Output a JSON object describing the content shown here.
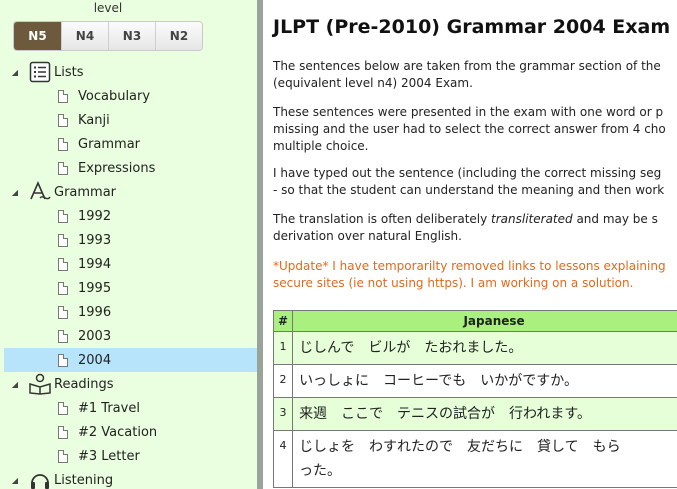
{
  "sidebar": {
    "level_label": "level",
    "levels": [
      {
        "label": "N5",
        "active": true
      },
      {
        "label": "N4",
        "active": false
      },
      {
        "label": "N3",
        "active": false
      },
      {
        "label": "N2",
        "active": false
      }
    ],
    "tree": {
      "lists": {
        "label": "Lists",
        "icon": "list-icon",
        "items": [
          "Vocabulary",
          "Kanji",
          "Grammar",
          "Expressions"
        ]
      },
      "grammar": {
        "label": "Grammar",
        "icon": "grammar-icon",
        "items": [
          "1992",
          "1993",
          "1994",
          "1995",
          "1996",
          "2003",
          "2004"
        ],
        "selected": "2004"
      },
      "readings": {
        "label": "Readings",
        "icon": "reading-icon",
        "items": [
          "#1 Travel",
          "#2 Vacation",
          "#3 Letter"
        ]
      },
      "listening": {
        "label": "Listening",
        "icon": "headphones-icon"
      }
    }
  },
  "content": {
    "title": "JLPT (Pre-2010) Grammar 2004 Exam",
    "paragraphs": [
      [
        "The sentences below are taken from the grammar section of the",
        "(equivalent level n4) 2004 Exam."
      ],
      [
        "These sentences were presented in the exam with one word or p",
        "missing and the user had to select the correct answer from 4 cho",
        "multiple choice."
      ],
      [
        "I have typed out the sentence (including the correct missing seg",
        "- so that the student can understand the meaning and then work"
      ],
      [
        "The translation is often deliberately ",
        "transliterated",
        " and may be s",
        "derivation over natural English."
      ]
    ],
    "update": [
      "*Update* I have temporarilty removed links to lessons explaining",
      "secure sites (ie not using https). I am working on a solution."
    ],
    "table": {
      "headers": [
        "#",
        "Japanese"
      ],
      "rows": [
        {
          "num": "1",
          "lines": [
            "じしんで　ビルが　たおれました。"
          ]
        },
        {
          "num": "2",
          "lines": [
            "いっしょに　コーヒーでも　いかがですか。"
          ]
        },
        {
          "num": "3",
          "lines": [
            "来週　ここで　テニスの試合が　行われます。"
          ]
        },
        {
          "num": "4",
          "lines": [
            "じしょを　わすれたので　友だちに　貸して　もら",
            "った。"
          ]
        }
      ]
    }
  },
  "colors": {
    "sidebar_bg": "#e9ffdf",
    "selected_bg": "#b7e3fb",
    "active_level": "#6d5a3d",
    "table_header": "#a9f07e",
    "update_text": "#e06a1c"
  }
}
